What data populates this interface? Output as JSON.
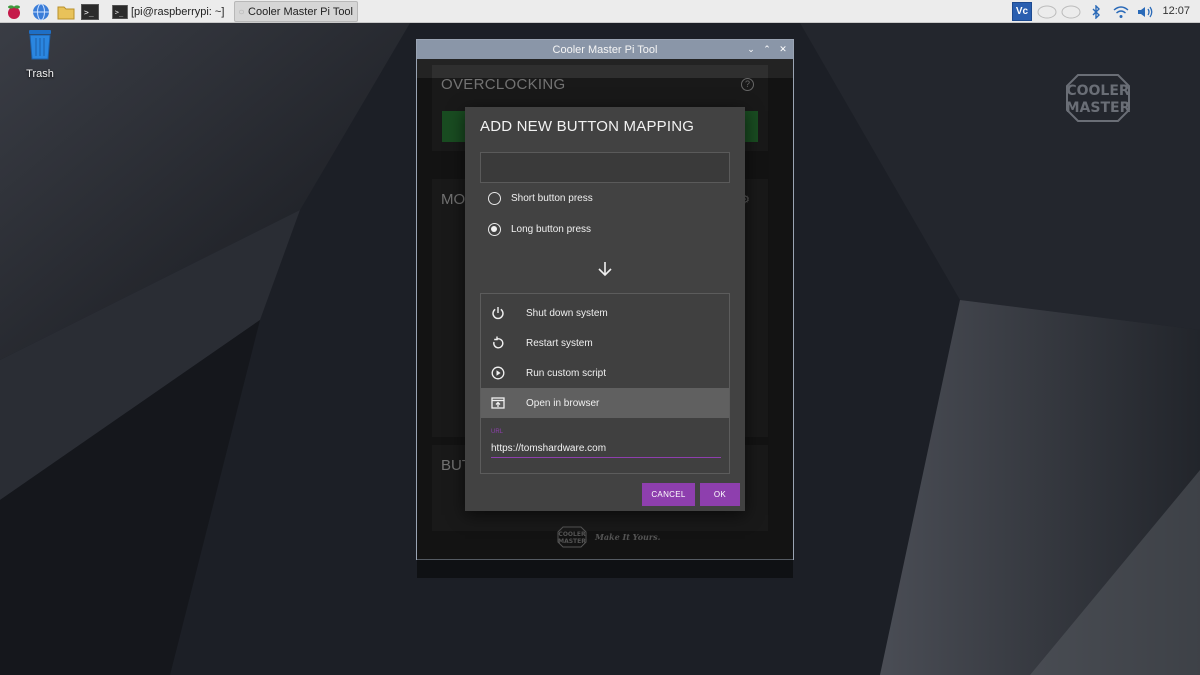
{
  "taskbar": {
    "terminal_task": "[pi@raspberrypi: ~]",
    "app_task": "Cooler Master Pi Tool",
    "clock": "12:07"
  },
  "desktop": {
    "trash_label": "Trash",
    "logo_line1": "COOLER",
    "logo_line2": "MASTER"
  },
  "window": {
    "title": "Cooler Master Pi Tool",
    "overclocking_title": "OVERCLOCKING",
    "monitoring_title_visible": "MON",
    "buttons_title_visible": "BUT",
    "footer_logo_line1": "COOLER",
    "footer_logo_line2": "MASTER",
    "footer_tagline": "Make It Yours."
  },
  "dialog": {
    "title": "ADD NEW BUTTON MAPPING",
    "name_value": "",
    "radio_short_label": "Short button press",
    "radio_long_label": "Long button press",
    "selected_press": "long",
    "actions": [
      {
        "label": "Shut down system",
        "icon": "power-icon"
      },
      {
        "label": "Restart system",
        "icon": "restart-icon"
      },
      {
        "label": "Run custom script",
        "icon": "play-icon"
      },
      {
        "label": "Open in browser",
        "icon": "browser-icon"
      }
    ],
    "selected_action": "Open in browser",
    "url_label": "URL",
    "url_value": "https://tomshardware.com",
    "cancel_label": "CANCEL",
    "ok_label": "OK"
  },
  "colors": {
    "accent": "#8e3fae",
    "green_button": "#2e8b3c",
    "dialog_bg": "#424242"
  }
}
